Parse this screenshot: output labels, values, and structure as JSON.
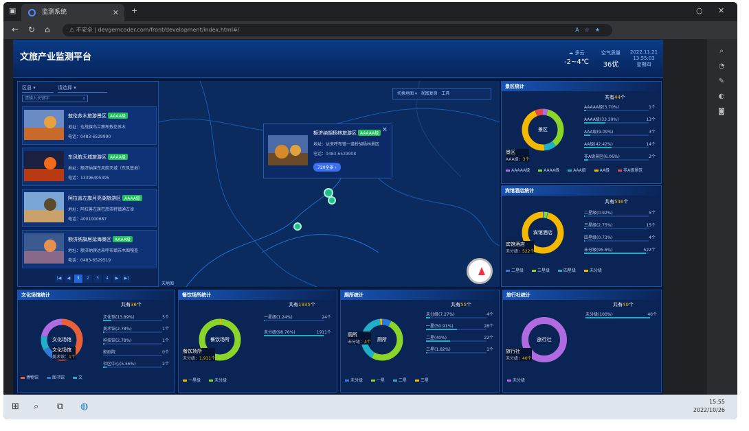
{
  "browser": {
    "tab_title": "监测系统",
    "url_warning": "不安全",
    "url": "devgemcoder.com/front/development/index.html#/"
  },
  "app": {
    "title": "文旅产业监测平台",
    "weather": {
      "label": "多云",
      "temp": "-2~4℃"
    },
    "aqi": {
      "label": "空气质量",
      "value": "36优"
    },
    "date": {
      "line1": "2022.11.21",
      "line2": "13:55:03",
      "line3": "星期四"
    }
  },
  "left": {
    "region_select": "区县",
    "type_select": "请选择",
    "search_placeholder": "请输入关键字",
    "cards": [
      {
        "name": "敖伦苏木旅游景区",
        "badge": "AAAA级",
        "addr": "地址：达茂旗乌兰察布敖伦苏木",
        "phone": "电话：0483-6529990"
      },
      {
        "name": "东风航天城旅游区",
        "badge": "AAAA级",
        "addr": "地址：额济纳旗东风航天城（东风基地）",
        "phone": "电话：13396405395"
      },
      {
        "name": "阿拉善左旗月亮湖旅游区",
        "badge": "AAAA级",
        "addr": "地址：阿拉善左旗巴彦浩特镇通古淖",
        "phone": "电话：4001000687"
      },
      {
        "name": "额济纳旗居延海景区",
        "badge": "AAAA级",
        "addr": "地址：额济纳旗达来呼布镇苏木图嘎查",
        "phone": "电话：0483-6529519"
      }
    ],
    "pager": [
      "|◀",
      "◀",
      "1",
      "2",
      "3",
      "4",
      "▶",
      "▶|"
    ]
  },
  "map": {
    "toolbar": {
      "layer": "切换地图",
      "reset": "视图复原",
      "tools": "工具"
    },
    "popup": {
      "name": "额济纳胡杨林旅游区",
      "badge": "AAAAA级",
      "addr": "地址：达来呼布镇一道桥胡杨林景区",
      "phone": "电话：0483-6529908",
      "button": "720全景 ›"
    },
    "logo": "天地图"
  },
  "panels": {
    "scenic": {
      "title": "景区统计",
      "total_prefix": "共有",
      "total": "44",
      "total_suffix": "个",
      "center": "景区",
      "rows": [
        {
          "label": "AAAAA级(3.70%)",
          "value": "1个",
          "pct": 3.7
        },
        {
          "label": "AAAA级(33.30%)",
          "value": "13个",
          "pct": 33.3
        },
        {
          "label": "AAA级(9.09%)",
          "value": "3个",
          "pct": 9.09
        },
        {
          "label": "AA级(42.42%)",
          "value": "14个",
          "pct": 42.42
        },
        {
          "label": "非A级景区(6.06%)",
          "value": "2个",
          "pct": 6.06
        }
      ],
      "tag": {
        "name": "景区",
        "sub": "AAA级：",
        "val": "3个"
      },
      "legend": [
        "AAAAA级",
        "AAAA级",
        "AAA级",
        "AA级",
        "非A级景区"
      ]
    },
    "hotel": {
      "title": "宾馆酒店统计",
      "total_prefix": "共有",
      "total": "546",
      "total_suffix": "个",
      "center": "宾馆酒店",
      "rows": [
        {
          "label": "二星级(0.92%)",
          "value": "5个",
          "pct": 0.92
        },
        {
          "label": "三星级(2.75%)",
          "value": "15个",
          "pct": 2.75
        },
        {
          "label": "四星级(0.73%)",
          "value": "4个",
          "pct": 0.73
        },
        {
          "label": "未分级(95.6%)",
          "value": "522个",
          "pct": 95.6
        }
      ],
      "tag": {
        "name": "宾馆酒店",
        "sub": "未分级：",
        "val": "522个"
      },
      "legend": [
        "二星级",
        "三星级",
        "四星级",
        "未分级"
      ]
    },
    "culture": {
      "title": "文化场馆统计",
      "total_prefix": "共有",
      "total": "36",
      "total_suffix": "个",
      "center": "文化场馆",
      "rows": [
        {
          "label": "文化馆(13.89%)",
          "value": "5个",
          "pct": 13.89
        },
        {
          "label": "美术馆(2.78%)",
          "value": "1个",
          "pct": 2.78
        },
        {
          "label": "科技馆(2.78%)",
          "value": "1个",
          "pct": 2.78
        },
        {
          "label": "影剧院",
          "value": "0个",
          "pct": 0
        },
        {
          "label": "社区中心(5.56%)",
          "value": "2个",
          "pct": 5.56
        }
      ],
      "tag": {
        "name": "文化场馆",
        "sub": "美术馆：",
        "val": "1个"
      },
      "legend": [
        "博物馆",
        "图书馆",
        "文"
      ]
    },
    "food": {
      "title": "餐饮场所统计",
      "total_prefix": "共有",
      "total": "1935",
      "total_suffix": "个",
      "center": "餐饮场所",
      "rows": [
        {
          "label": "一星级(1.24%)",
          "value": "24个",
          "pct": 1.24
        },
        {
          "label": "未分级(98.76%)",
          "value": "1911个",
          "pct": 98.76
        }
      ],
      "tag": {
        "name": "餐饮场所",
        "sub": "未分级：",
        "val": "1,911个"
      },
      "legend": [
        "一星级",
        "未分级"
      ]
    },
    "toilet": {
      "title": "厕所统计",
      "total_prefix": "共有",
      "total": "55",
      "total_suffix": "个",
      "center": "厕所",
      "rows": [
        {
          "label": "未分级(7.27%)",
          "value": "4个",
          "pct": 7.27
        },
        {
          "label": "一星(50.91%)",
          "value": "28个",
          "pct": 50.91
        },
        {
          "label": "二星(40%)",
          "value": "22个",
          "pct": 40
        },
        {
          "label": "三星(1.82%)",
          "value": "1个",
          "pct": 1.82
        }
      ],
      "tag": {
        "name": "厕所",
        "sub": "未分级：",
        "val": "4个"
      },
      "legend": [
        "未分级",
        "一星",
        "二星",
        "三星"
      ]
    },
    "agency": {
      "title": "旅行社统计",
      "total_prefix": "共有",
      "total": "40",
      "total_suffix": "个",
      "center": "旅行社",
      "rows": [
        {
          "label": "未分级(100%)",
          "value": "40个",
          "pct": 100
        }
      ],
      "tag": {
        "name": "旅行社",
        "sub": "未分级：",
        "val": "40个"
      },
      "legend": [
        "未分级"
      ]
    }
  },
  "taskbar": {
    "time": "15:55",
    "date": "2022/10/26"
  }
}
